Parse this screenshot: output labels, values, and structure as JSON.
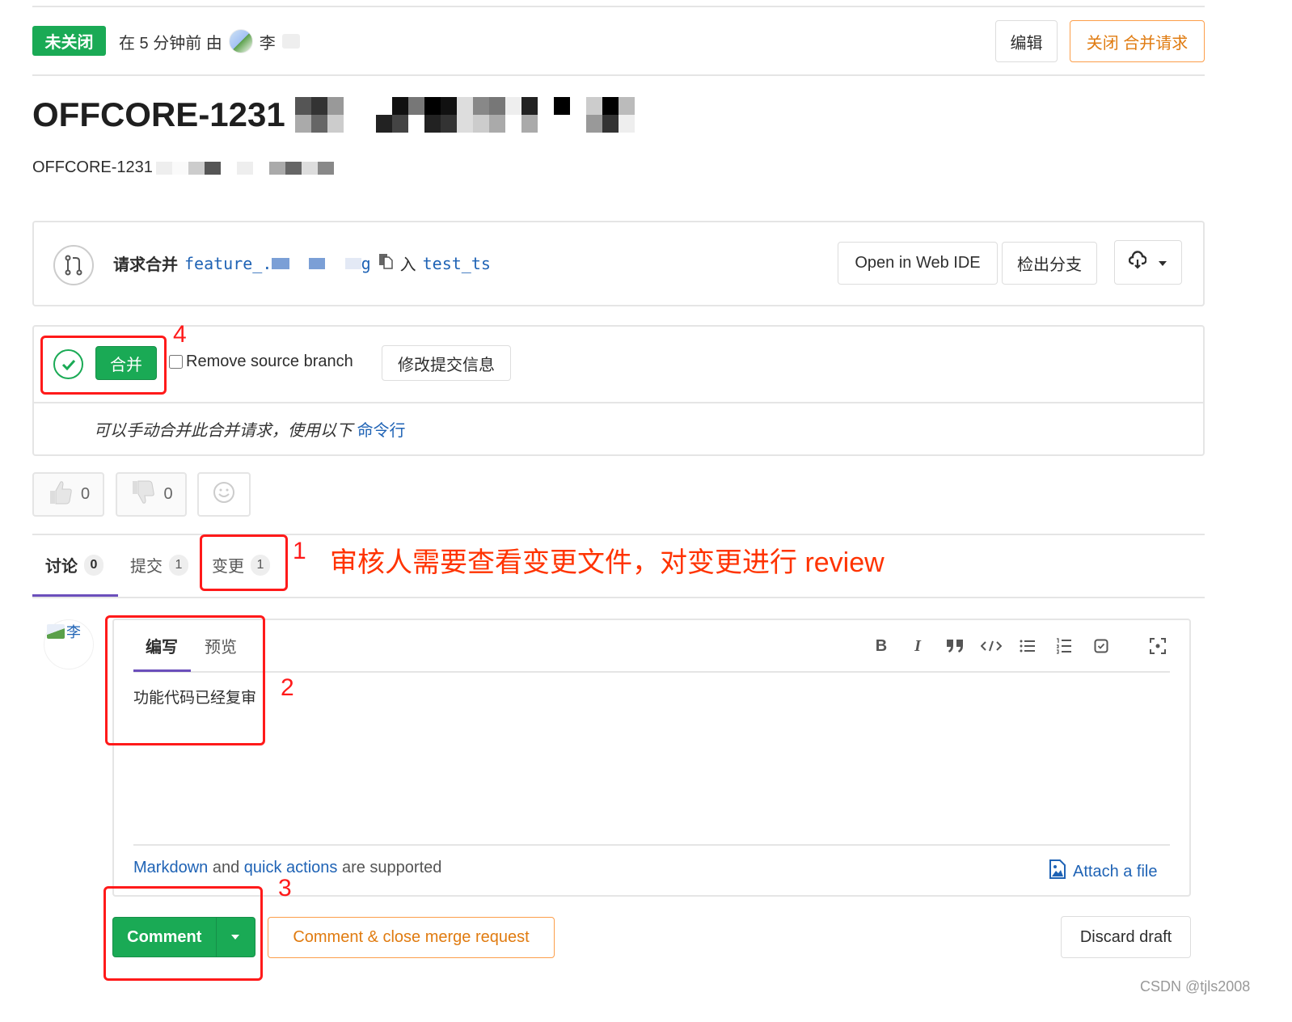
{
  "header": {
    "status": "未关闭",
    "opened_text": "在 5 分钟前 由",
    "author": "李",
    "edit_label": "编辑",
    "close_label": "关闭 合并请求"
  },
  "title": {
    "prefix": "OFFCORE-1231",
    "description_prefix": "OFFCORE-1231"
  },
  "branch": {
    "request_label": "请求合并",
    "source_branch_start": "feature_.",
    "source_branch_end": "g",
    "into_label": "入",
    "target_branch": "test_ts",
    "web_ide_label": "Open in Web IDE",
    "checkout_label": "检出分支"
  },
  "merge": {
    "merge_label": "合并",
    "remove_source_label": "Remove source branch",
    "remove_source_checked": false,
    "edit_commit_label": "修改提交信息",
    "manual_text": "可以手动合并此合并请求，使用以下",
    "command_line_link": "命令行"
  },
  "awards": {
    "thumbs_up_count": "0",
    "thumbs_down_count": "0"
  },
  "tabs": [
    {
      "label": "讨论",
      "count": "0",
      "active": true
    },
    {
      "label": "提交",
      "count": "1",
      "active": false
    },
    {
      "label": "变更",
      "count": "1",
      "active": false
    }
  ],
  "annotations": {
    "n1": "1",
    "n1_text": "审核人需要查看变更文件，对变更进行 review",
    "n2": "2",
    "n3": "3",
    "n4": "4"
  },
  "comment_form": {
    "avatar_label": "李",
    "tab_write": "编写",
    "tab_preview": "预览",
    "toolbar": [
      "bold-icon",
      "italic-icon",
      "quote-icon",
      "code-icon",
      "bullet-list-icon",
      "numbered-list-icon",
      "task-list-icon",
      "fullscreen-icon"
    ],
    "text": "功能代码已经复审",
    "markdown_link": "Markdown",
    "and_text": "and",
    "quick_actions_link": "quick actions",
    "supported_text": "are supported",
    "attach_label": "Attach a file",
    "comment_label": "Comment",
    "comment_close_label": "Comment & close merge request",
    "discard_label": "Discard draft"
  },
  "watermark": "CSDN @tjls2008",
  "colors": {
    "success": "#1aaa55",
    "warning": "#e07b10",
    "link": "#1f63b5",
    "annotation": "#ff1a1a",
    "tab_active": "#6b4fbb"
  }
}
